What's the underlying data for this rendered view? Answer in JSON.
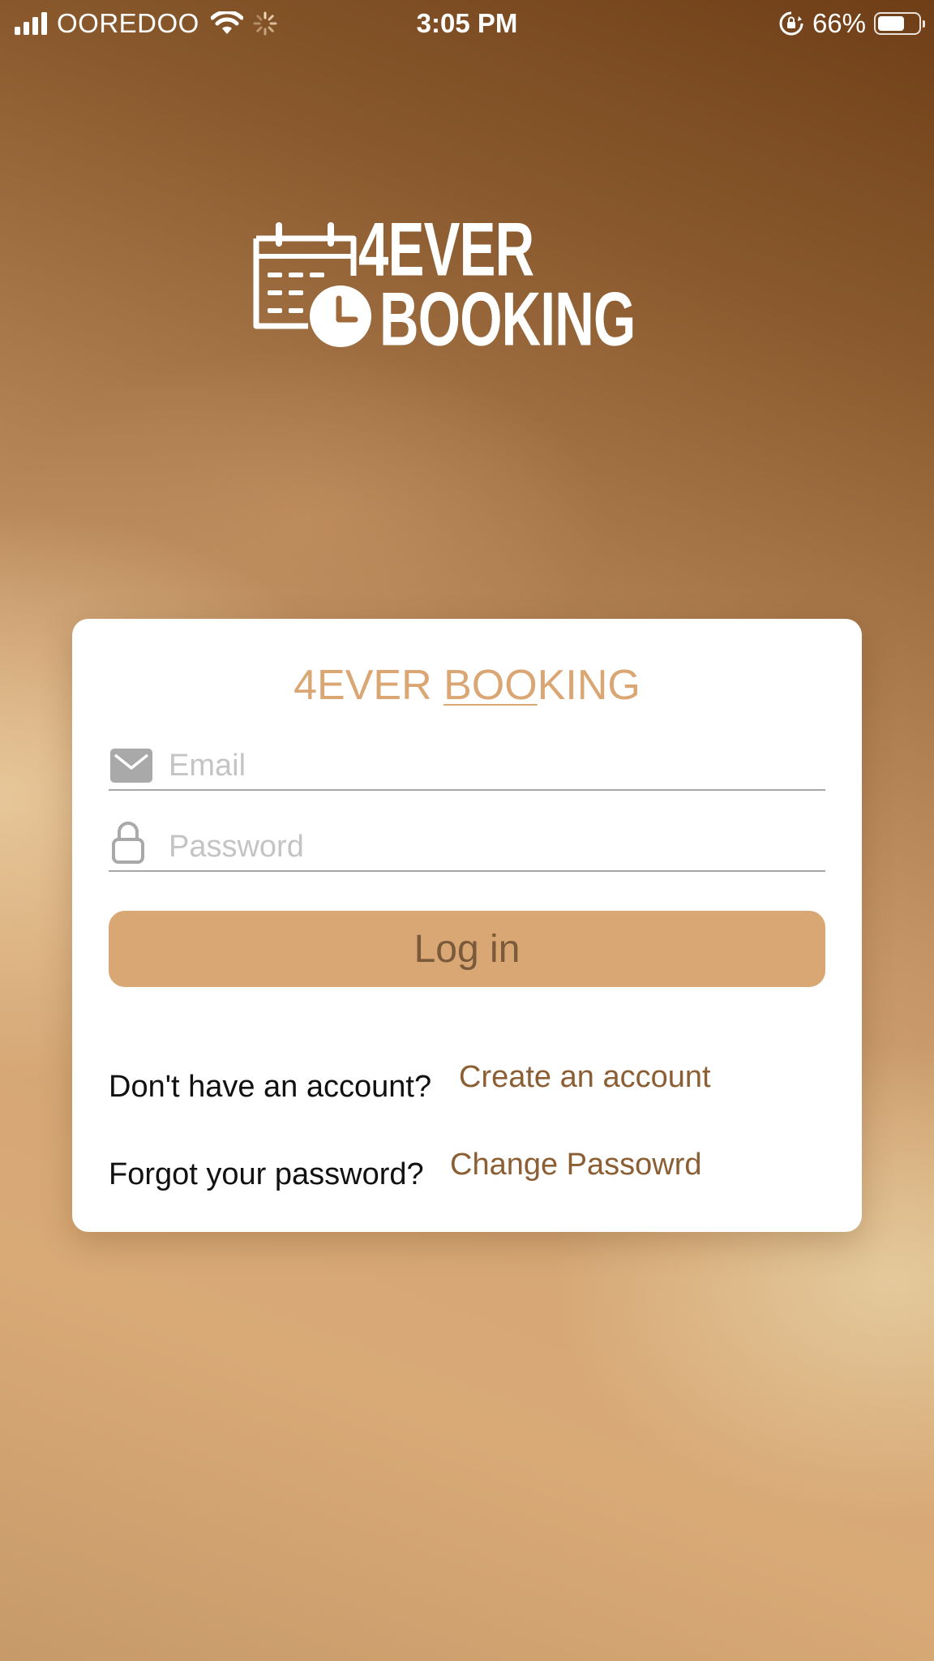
{
  "status_bar": {
    "carrier": "OOREDOO",
    "time": "3:05 PM",
    "battery_percent": "66%",
    "battery_level": 0.66,
    "icons": [
      "signal-icon",
      "wifi-icon",
      "activity-spinner-icon",
      "orientation-lock-icon",
      "battery-icon"
    ]
  },
  "logo": {
    "line1": "4EVER",
    "line2": "BOOKING",
    "icon": "calendar-clock-icon"
  },
  "login_card": {
    "title_part1": "4EVER ",
    "title_part2": "BOO",
    "title_part3": "KING",
    "email": {
      "placeholder": "Email",
      "value": "",
      "icon": "envelope-icon"
    },
    "password": {
      "placeholder": "Password",
      "value": "",
      "icon": "lock-icon"
    },
    "login_button": "Log in",
    "signup_prompt": "Don't have an account?",
    "signup_link": "Create an account",
    "forgot_prompt": "Forgot your password?",
    "forgot_link": "Change Passowrd"
  },
  "colors": {
    "accent": "#d9a774",
    "title": "#d9a674",
    "link": "#8b5e34",
    "button_text": "#7a5a3a",
    "field_line": "#a7a7a7",
    "placeholder": "#c4c4c4"
  }
}
